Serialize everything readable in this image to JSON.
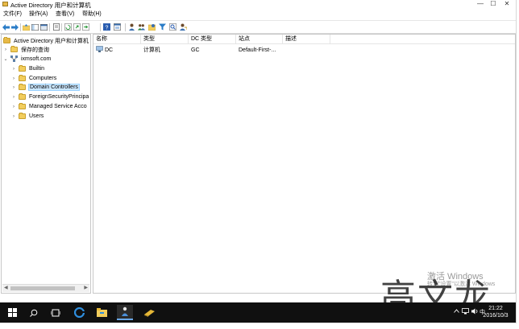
{
  "window": {
    "title": "Active Directory 用户和计算机",
    "controls": {
      "minimize": "—",
      "maximize": "☐",
      "close": "✕"
    }
  },
  "menu": {
    "items": [
      {
        "label": "文件(F)"
      },
      {
        "label": "操作(A)"
      },
      {
        "label": "查看(V)"
      },
      {
        "label": "帮助(H)"
      }
    ]
  },
  "toolbar": {
    "icons": [
      "back-arrow-icon",
      "forward-arrow-icon",
      "folder-up-icon",
      "show-tree-icon",
      "console-icon",
      "properties-icon",
      "refresh-icon",
      "export-icon",
      "help-icon",
      "snapin-icon",
      "new-user-icon",
      "new-group-icon",
      "new-ou-icon",
      "filter-icon",
      "find-icon",
      "delegate-icon"
    ]
  },
  "tree": {
    "root": "Active Directory 用户和计算机",
    "saved_queries": "保存的查询",
    "domain": "ixmsoft.com",
    "children": [
      {
        "label": "Builtin"
      },
      {
        "label": "Computers"
      },
      {
        "label": "Domain Controllers"
      },
      {
        "label": "ForeignSecurityPrincipa"
      },
      {
        "label": "Managed Service Acco"
      },
      {
        "label": "Users"
      }
    ],
    "selected": "Domain Controllers"
  },
  "list": {
    "columns": [
      "名称",
      "类型",
      "DC 类型",
      "站点",
      "描述"
    ],
    "rows": [
      {
        "name": "DC",
        "type": "计算机",
        "dc_type": "GC",
        "site": "Default-First-...",
        "description": ""
      }
    ]
  },
  "watermark": {
    "activate_line1": "激活 Windows",
    "activate_line2": "转到\"设置\"以激活 Windows",
    "signature": "高文龙"
  },
  "taskbar": {
    "ime": "中",
    "time": "21:22",
    "date": "2016/10/3"
  },
  "colors": {
    "taskbar": "#101010",
    "selection": "#cce8ff",
    "folder": "#f2cd5c"
  }
}
